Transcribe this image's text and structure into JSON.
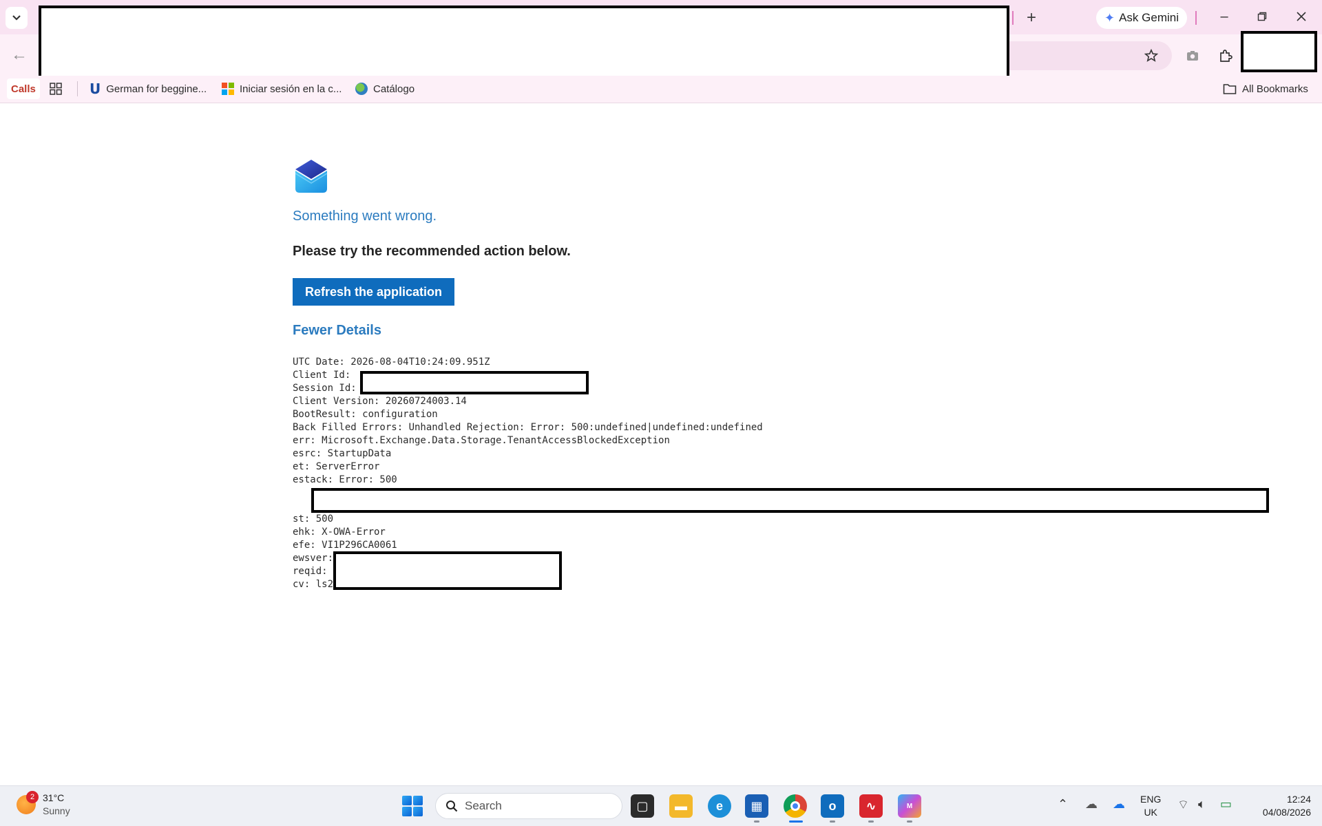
{
  "browser": {
    "gemini_label": "Ask Gemini",
    "bookmarks": {
      "calls": "Calls",
      "german": "German for beggine...",
      "iniciar": "Iniciar sesión en la c...",
      "catalogo": "Catálogo",
      "all": "All Bookmarks"
    }
  },
  "page": {
    "title": "Something went wrong.",
    "subtitle": "Please try the recommended action below.",
    "refresh_label": "Refresh the application",
    "details_toggle": "Fewer Details",
    "details": {
      "utc": "UTC Date: 2026-08-04T10:24:09.951Z",
      "client_id": "Client Id:",
      "session_id": "Session Id:",
      "client_version": "Client Version: 20260724003.14",
      "boot_result": "BootResult: configuration",
      "back_filled": "Back Filled Errors: Unhandled Rejection: Error: 500:undefined|undefined:undefined",
      "err": "err: Microsoft.Exchange.Data.Storage.TenantAccessBlockedException",
      "esrc": "esrc: StartupData",
      "et": "et: ServerError",
      "estack": "estack: Error: 500",
      "st": "st: 500",
      "ehk": "ehk: X-OWA-Error",
      "efe": "efe: VI1P296CA0061",
      "ewsver": "ewsver:",
      "reqid": "reqid:",
      "cv": "cv: ls2"
    }
  },
  "taskbar": {
    "weather_temp": "31°C",
    "weather_cond": "Sunny",
    "weather_badge": "2",
    "search_placeholder": "Search",
    "lang_top": "ENG",
    "lang_bottom": "UK",
    "time": "12:24",
    "date": "04/08/2026"
  },
  "colors": {
    "accent": "#0f6cbd",
    "link": "#2b7bbf",
    "tabstrip": "#f9e3f2"
  }
}
